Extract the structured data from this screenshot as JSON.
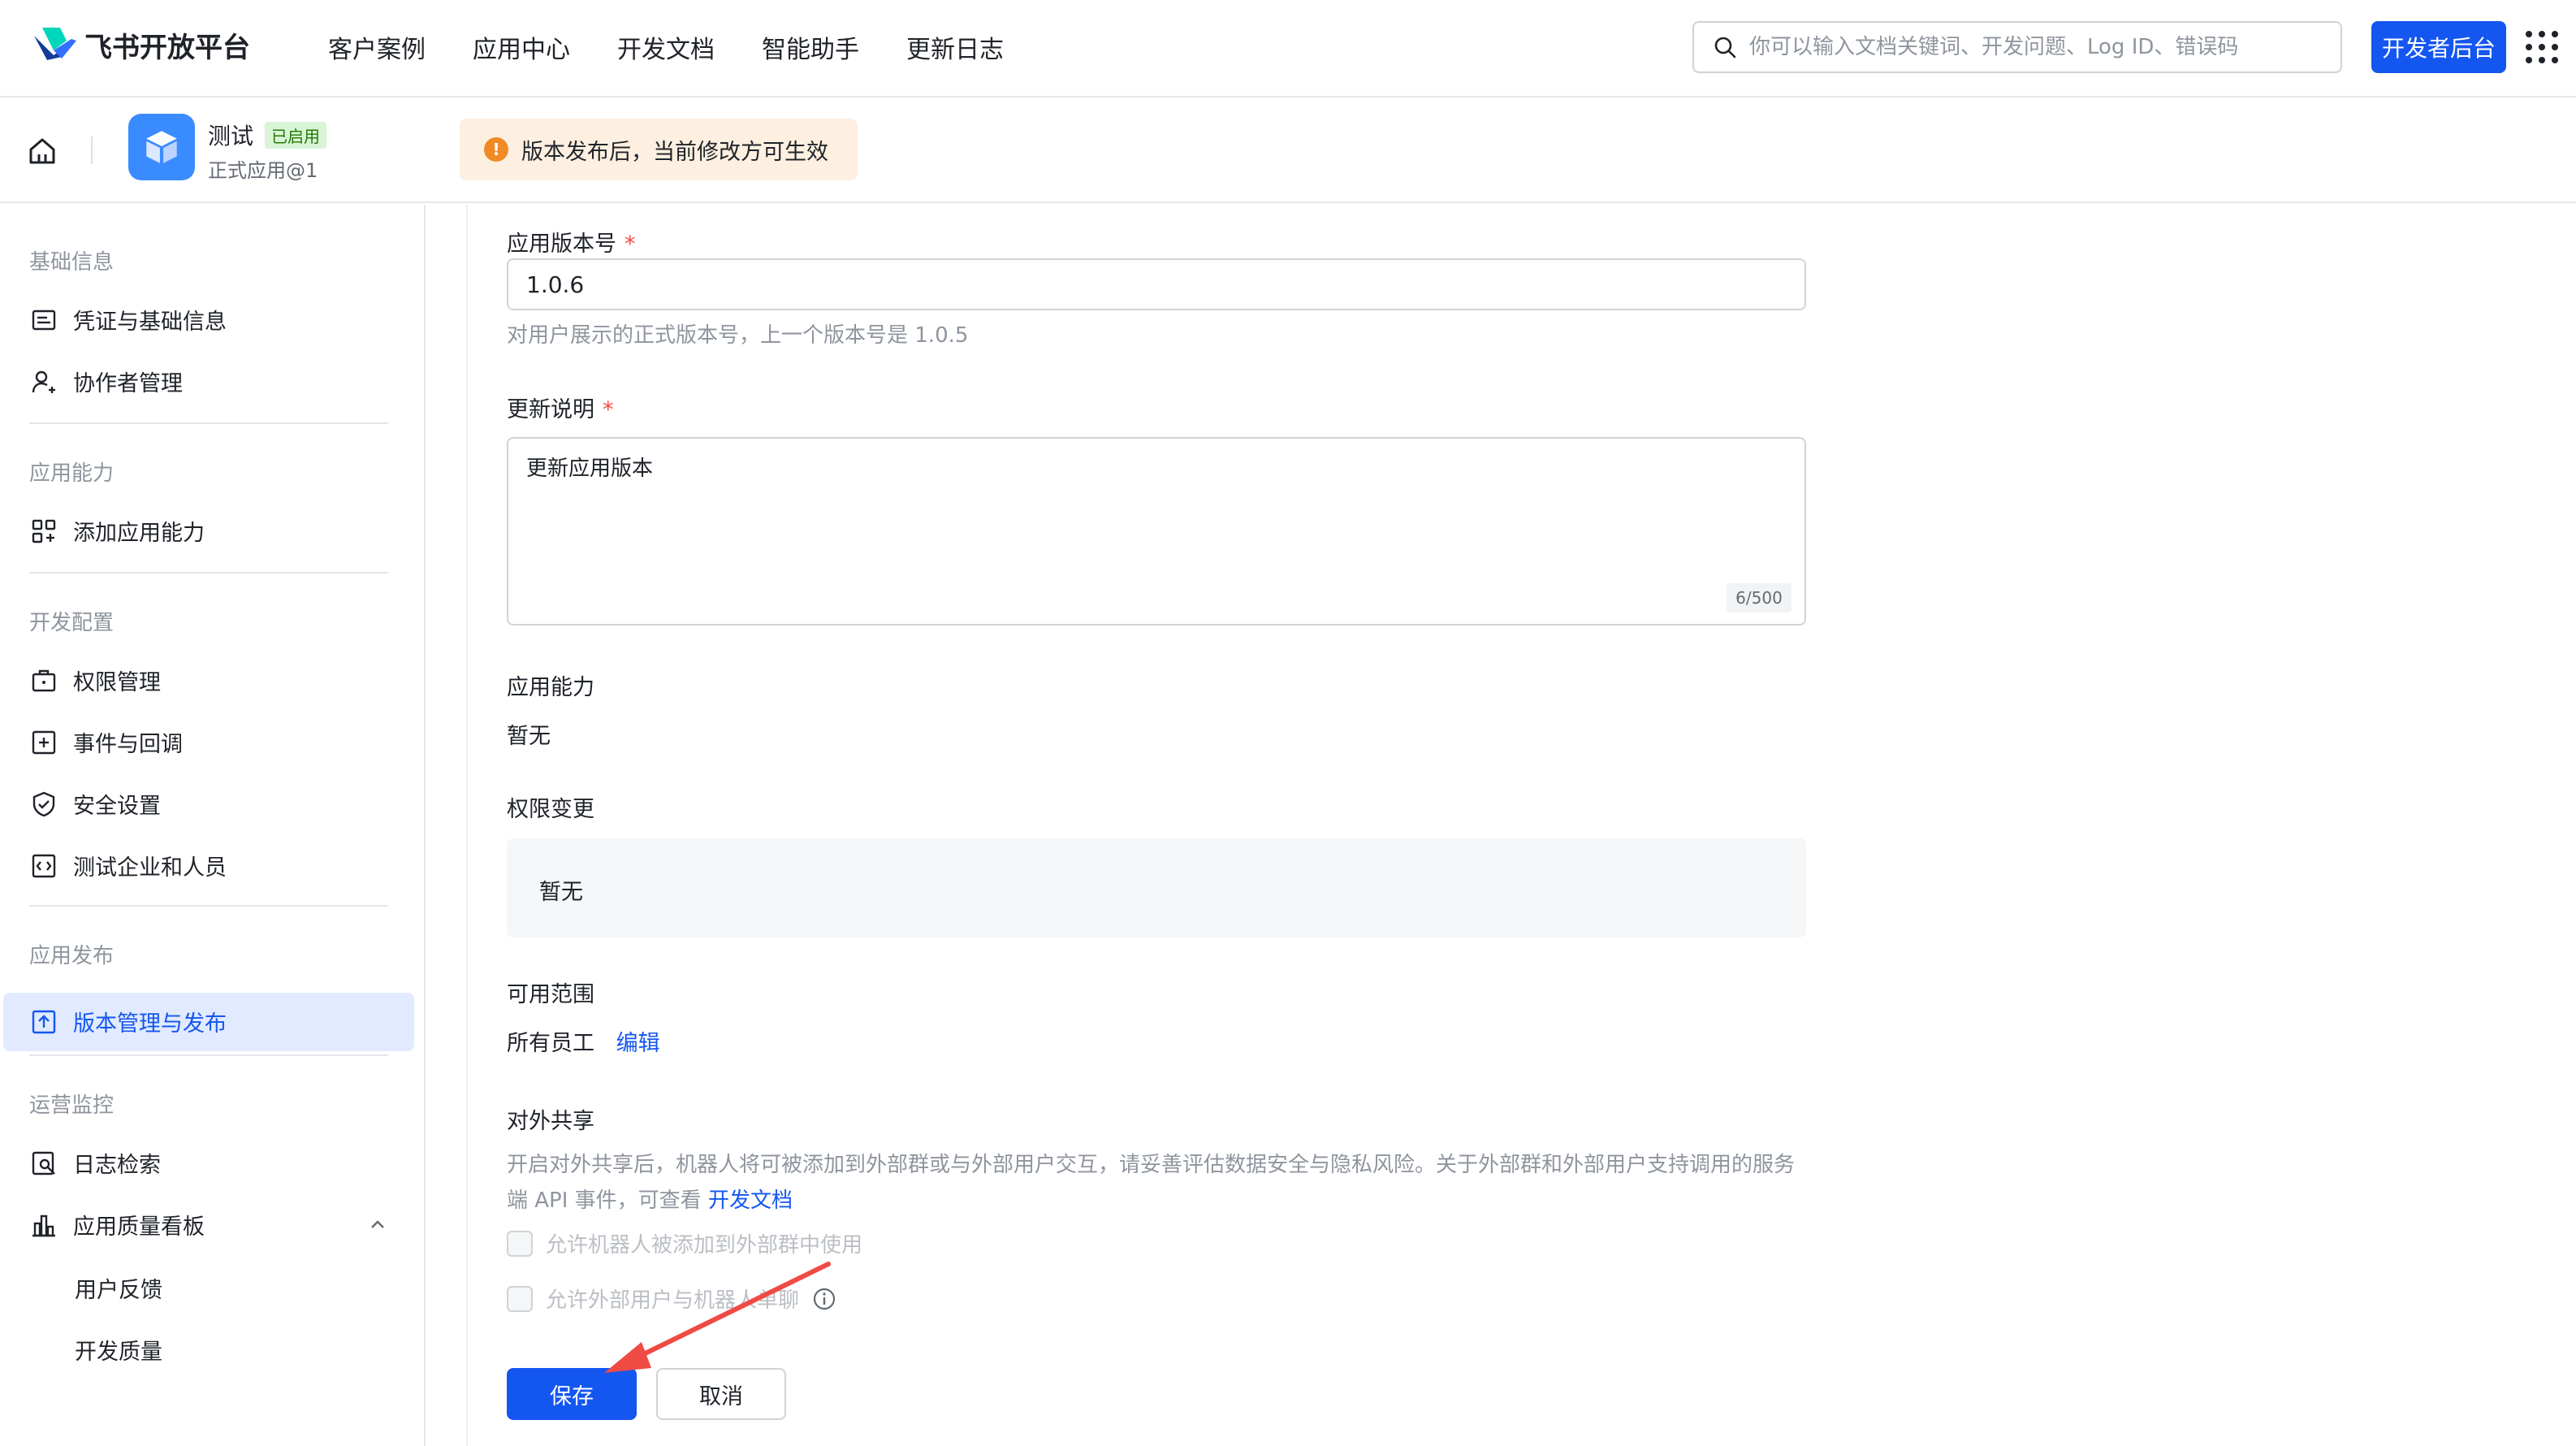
{
  "header": {
    "brand": "飞书开放平台",
    "nav": [
      "客户案例",
      "应用中心",
      "开发文档",
      "智能助手",
      "更新日志"
    ],
    "search_placeholder": "你可以输入文档关键词、开发问题、Log ID、错误码",
    "dev_console_label": "开发者后台",
    "icons": {
      "search": "search-icon",
      "apps": "grid-menu-icon"
    }
  },
  "app": {
    "name": "测试",
    "status_badge": "已启用",
    "subtitle": "正式应用@1",
    "notice": "版本发布后，当前修改方可生效",
    "notice_icon": "!",
    "accent": "#1456f0"
  },
  "sidebar": {
    "sections": [
      {
        "title": "基础信息",
        "items": [
          "凭证与基础信息",
          "协作者管理"
        ]
      },
      {
        "title": "应用能力",
        "items": [
          "添加应用能力"
        ]
      },
      {
        "title": "开发配置",
        "items": [
          "权限管理",
          "事件与回调",
          "安全设置",
          "测试企业和人员"
        ]
      },
      {
        "title": "应用发布",
        "items": [
          "版本管理与发布"
        ]
      },
      {
        "title": "运营监控",
        "items": [
          "日志检索",
          "应用质量看板"
        ],
        "subitems": [
          "用户反馈",
          "开发质量"
        ]
      }
    ],
    "active_item": "版本管理与发布"
  },
  "form": {
    "version": {
      "label": "应用版本号",
      "required_mark": "*",
      "value": "1.0.6",
      "hint": "对用户展示的正式版本号，上一个版本号是 1.0.5"
    },
    "notes": {
      "label": "更新说明",
      "required_mark": "*",
      "value": "更新应用版本",
      "counter": "6/500"
    },
    "capability": {
      "label": "应用能力",
      "value": "暂无"
    },
    "permissions": {
      "label": "权限变更",
      "value": "暂无"
    },
    "scope": {
      "label": "可用范围",
      "value": "所有员工",
      "edit_link": "编辑"
    },
    "sharing": {
      "label": "对外共享",
      "description": "开启对外共享后，机器人将可被添加到外部群或与外部用户交互，请妥善评估数据安全与隐私风险。关于外部群和外部用户支持调用的服务端 API 事件，可查看",
      "doc_link": "开发文档",
      "options": [
        "允许机器人被添加到外部群中使用",
        "允许外部用户与机器人单聊"
      ],
      "checked": [
        false,
        false
      ]
    },
    "save_label": "保存",
    "cancel_label": "取消"
  },
  "annotation": {
    "color": "#f04a45"
  }
}
